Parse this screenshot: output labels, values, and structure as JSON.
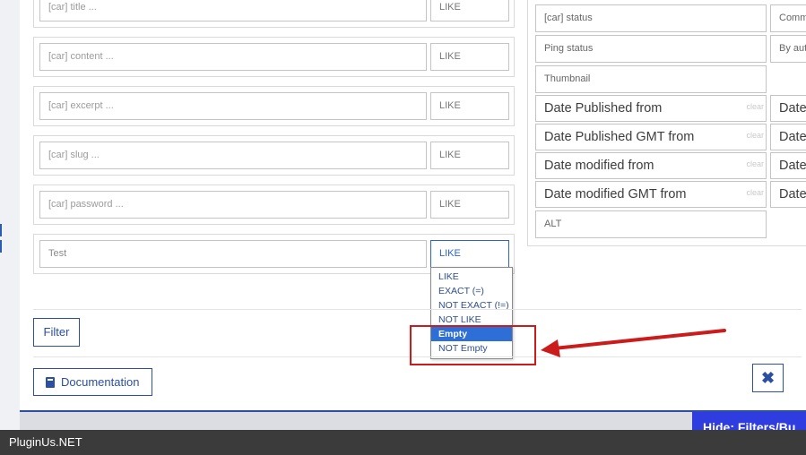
{
  "filters": [
    {
      "placeholder": "[car] title ...",
      "operator": "LIKE"
    },
    {
      "placeholder": "[car] content ...",
      "operator": "LIKE"
    },
    {
      "placeholder": "[car] excerpt ...",
      "operator": "LIKE"
    },
    {
      "placeholder": "[car] slug ...",
      "operator": "LIKE"
    },
    {
      "placeholder": "[car] password ...",
      "operator": "LIKE"
    },
    {
      "value": "Test",
      "operator": "LIKE"
    }
  ],
  "operator_dropdown": {
    "options": [
      "LIKE",
      "EXACT (=)",
      "NOT EXACT (!=)",
      "NOT LIKE",
      "Empty",
      "NOT Empty"
    ],
    "highlighted": "Empty"
  },
  "right_fields": {
    "status": "[car] status",
    "comment_partial": "Comm",
    "ping_status": "Ping status",
    "author_partial": "By aut",
    "thumbnail": "Thumbnail",
    "date_published_from": "Date Published from",
    "date_published_gmt_from": "Date Published GMT from",
    "date_modified_from": "Date modified from",
    "date_modified_gmt_from": "Date modified GMT from",
    "date_partial": "Date",
    "clear_label": "clear",
    "alt": "ALT"
  },
  "buttons": {
    "filter_label": "Filter",
    "documentation_label": "Documentation",
    "close_icon": "✖",
    "hide_partial": "Hide: Filters/Bu"
  },
  "footer": {
    "brand": "PluginUs.NET"
  },
  "colors": {
    "accent": "#2b4fa3",
    "highlight": "#2d6fd6",
    "annotation": "#cc1b1b",
    "tab": "#2f3cdf"
  }
}
